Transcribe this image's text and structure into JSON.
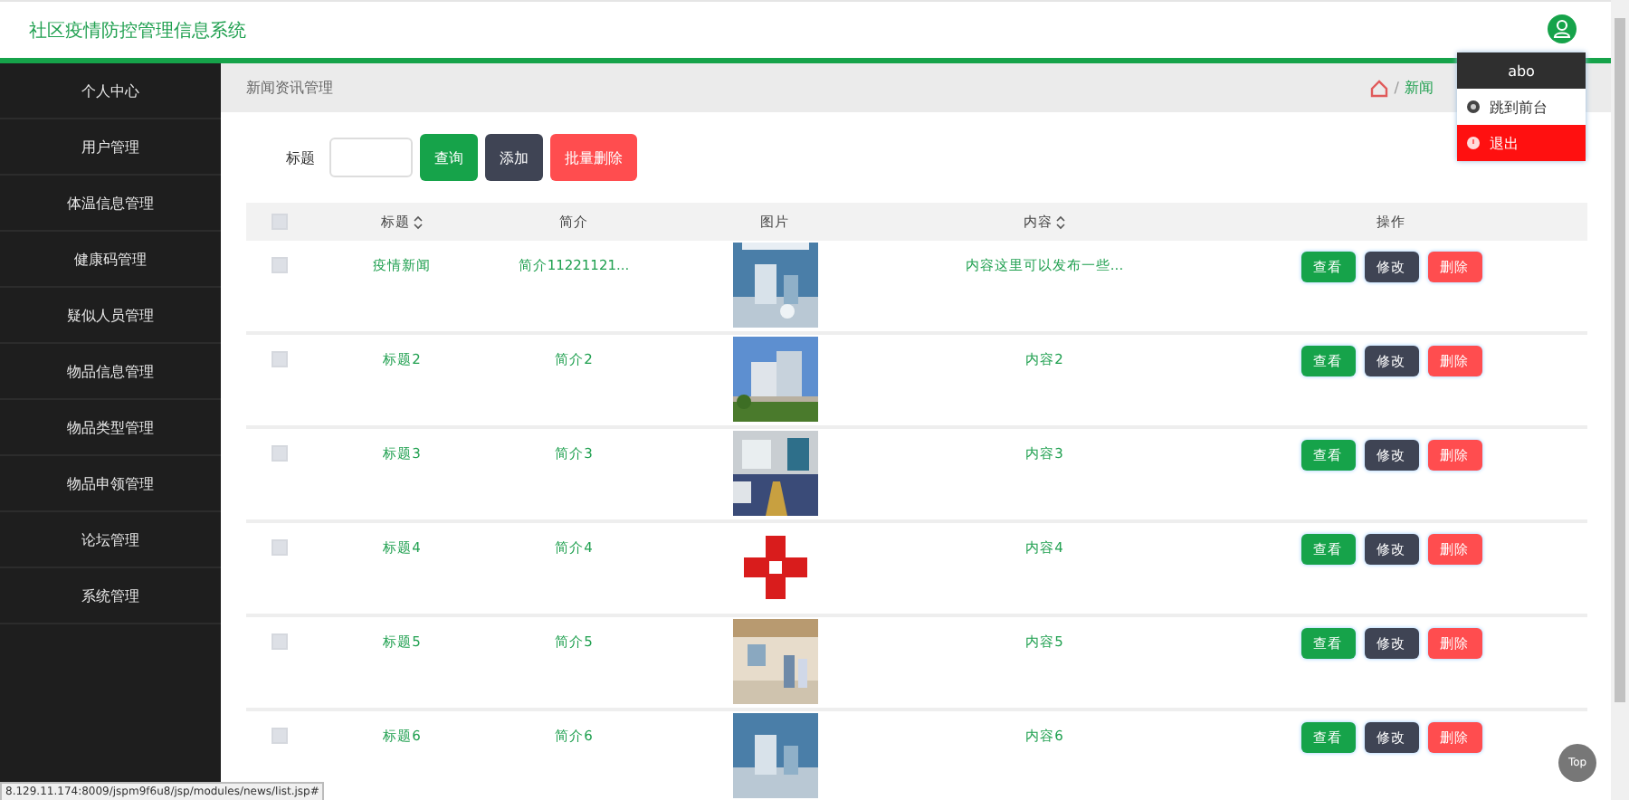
{
  "header": {
    "title": "社区疫情防控管理信息系统"
  },
  "user_menu": {
    "username": "abo",
    "items": [
      {
        "label": "跳到前台",
        "kind": "normal"
      },
      {
        "label": "退出",
        "kind": "danger"
      }
    ]
  },
  "sidebar": {
    "items": [
      {
        "label": "个人中心"
      },
      {
        "label": "用户管理"
      },
      {
        "label": "体温信息管理"
      },
      {
        "label": "健康码管理"
      },
      {
        "label": "疑似人员管理"
      },
      {
        "label": "物品信息管理"
      },
      {
        "label": "物品类型管理"
      },
      {
        "label": "物品申领管理"
      },
      {
        "label": "论坛管理"
      },
      {
        "label": "系统管理"
      }
    ]
  },
  "breadcrumb": {
    "page": "新闻资讯管理",
    "separator": "/",
    "trail": "新闻"
  },
  "search": {
    "label": "标题",
    "buttons": [
      {
        "label": "查询",
        "kind": "search"
      },
      {
        "label": "添加",
        "kind": "add"
      },
      {
        "label": "批量删除",
        "kind": "delete"
      }
    ]
  },
  "table": {
    "select_all_checked": false,
    "columns": [
      {
        "label": "标题",
        "sortable": true
      },
      {
        "label": "简介",
        "sortable": false
      },
      {
        "label": "图片",
        "sortable": false
      },
      {
        "label": "内容",
        "sortable": true
      },
      {
        "label": "操作",
        "sortable": false
      }
    ],
    "rows": [
      {
        "checked": false,
        "title": "疫情新闻",
        "summary": "简介11221121...",
        "content": "内容这里可以发布一些...",
        "actions": [
          {
            "label": "查看",
            "kind": "view"
          },
          {
            "label": "修改",
            "kind": "edit"
          },
          {
            "label": "删除",
            "kind": "delete"
          }
        ]
      },
      {
        "checked": false,
        "title": "标题2",
        "summary": "简介2",
        "content": "内容2",
        "actions": [
          {
            "label": "查看",
            "kind": "view"
          },
          {
            "label": "修改",
            "kind": "edit"
          },
          {
            "label": "删除",
            "kind": "delete"
          }
        ]
      },
      {
        "checked": false,
        "title": "标题3",
        "summary": "简介3",
        "content": "内容3",
        "actions": [
          {
            "label": "查看",
            "kind": "view"
          },
          {
            "label": "修改",
            "kind": "edit"
          },
          {
            "label": "删除",
            "kind": "delete"
          }
        ]
      },
      {
        "checked": false,
        "title": "标题4",
        "summary": "简介4",
        "content": "内容4",
        "actions": [
          {
            "label": "查看",
            "kind": "view"
          },
          {
            "label": "修改",
            "kind": "edit"
          },
          {
            "label": "删除",
            "kind": "delete"
          }
        ]
      },
      {
        "checked": false,
        "title": "标题5",
        "summary": "简介5",
        "content": "内容5",
        "actions": [
          {
            "label": "查看",
            "kind": "view"
          },
          {
            "label": "修改",
            "kind": "edit"
          },
          {
            "label": "删除",
            "kind": "delete"
          }
        ]
      },
      {
        "checked": false,
        "title": "标题6",
        "summary": "简介6",
        "content": "内容6",
        "actions": [
          {
            "label": "查看",
            "kind": "view"
          },
          {
            "label": "修改",
            "kind": "edit"
          },
          {
            "label": "删除",
            "kind": "delete"
          }
        ]
      }
    ]
  },
  "back_to_top": "Top",
  "status_bar": "8.129.11.174:8009/jspm9f6u8/jsp/modules/news/list.jsp#"
}
